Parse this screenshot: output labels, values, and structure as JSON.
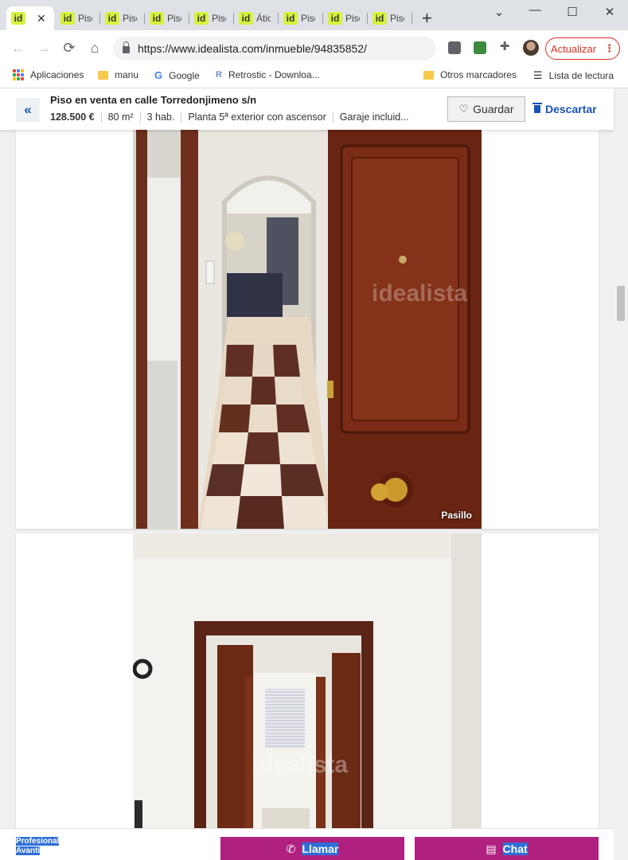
{
  "browser": {
    "tabs": [
      {
        "favicon": "id",
        "title": ""
      },
      {
        "favicon": "id",
        "title": "Piso"
      },
      {
        "favicon": "id",
        "title": "Piso"
      },
      {
        "favicon": "id",
        "title": "Piso"
      },
      {
        "favicon": "id",
        "title": "Piso"
      },
      {
        "favicon": "id",
        "title": "Ático"
      },
      {
        "favicon": "id",
        "title": "Piso"
      },
      {
        "favicon": "id",
        "title": "Piso"
      },
      {
        "favicon": "id",
        "title": "Piso"
      }
    ],
    "new_tab": "+",
    "window": {
      "minimize": "⌄ —",
      "maximize": "☐",
      "close": "✕"
    },
    "url": "https://www.idealista.com/inmueble/94835852/",
    "update_label": "Actualizar",
    "bookmarks": [
      "Aplicaciones",
      "manu",
      "Google",
      "Retrostic - Downloa...",
      "Otros marcadores",
      "Lista de lectura"
    ],
    "icons": {
      "back": "arrow-left-icon",
      "forward": "arrow-right-icon",
      "reload": "reload-icon",
      "home": "home-icon",
      "lock": "lock-icon",
      "extensions": "puzzle-icon",
      "menu": "more-vert-icon"
    },
    "accent": "#d93025"
  },
  "listing": {
    "title": "Piso en venta en calle Torredonjimeno s/n",
    "price": "128.500 €",
    "features": [
      "80 m²",
      "3 hab.",
      "Planta 5ª exterior con ascensor",
      "Garaje incluid..."
    ],
    "save_label": "Guardar",
    "discard_label": "Descartar",
    "brand_color": "#1a53b5"
  },
  "photos": [
    {
      "caption": "Pasillo",
      "watermark": "idealista"
    },
    {
      "caption": "",
      "watermark": "idealista"
    }
  ],
  "bottom": {
    "profile_line1": "Profesional",
    "profile_line2": "Avanti",
    "call_label": "Llamar",
    "chat_label": "Chat",
    "cta_color": "#b0217f"
  }
}
